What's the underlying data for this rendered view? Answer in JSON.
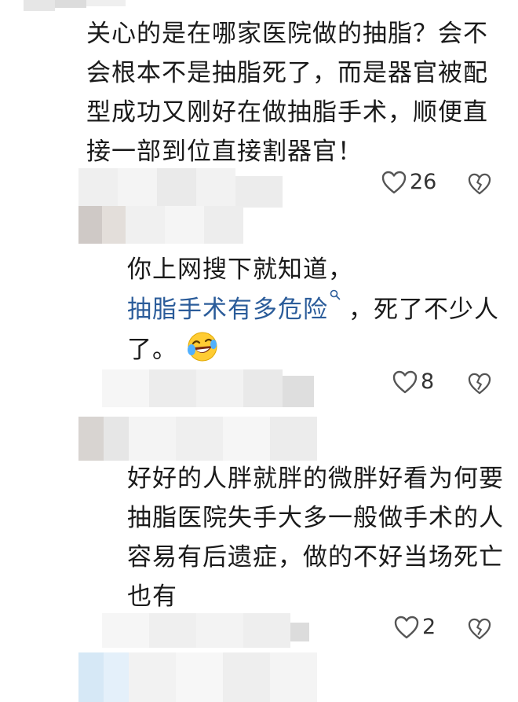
{
  "comments": [
    {
      "lines": [
        "关心的是在哪家医院做的抽脂？会不",
        "会根本不是抽脂死了，而是器官被配",
        "型成功又刚好在做抽脂手术，顺便直",
        "接一部到位直接割器官！"
      ],
      "like_count": "26"
    },
    {
      "line1": "你上网搜下就知道，",
      "link_text": "抽脂手术有多危险",
      "line2_after": "，死了不少人",
      "line3": "了。",
      "emoji": "laughing-with-tears-emoji",
      "like_count": "8"
    },
    {
      "lines": [
        "好好的人胖就胖的微胖好看为何要",
        "抽脂医院失手大多一般做手术的人",
        "容易有后遗症，做的不好当场死亡",
        "也有"
      ],
      "like_count": "2"
    }
  ],
  "icons": {
    "like": "heart-outline-icon",
    "dislike": "broken-heart-outline-icon",
    "search": "search-icon"
  },
  "colors": {
    "link": "#2b5c9a",
    "text": "#1a1a1a",
    "icon": "#555555",
    "mosaic": "#d9d9d9"
  }
}
